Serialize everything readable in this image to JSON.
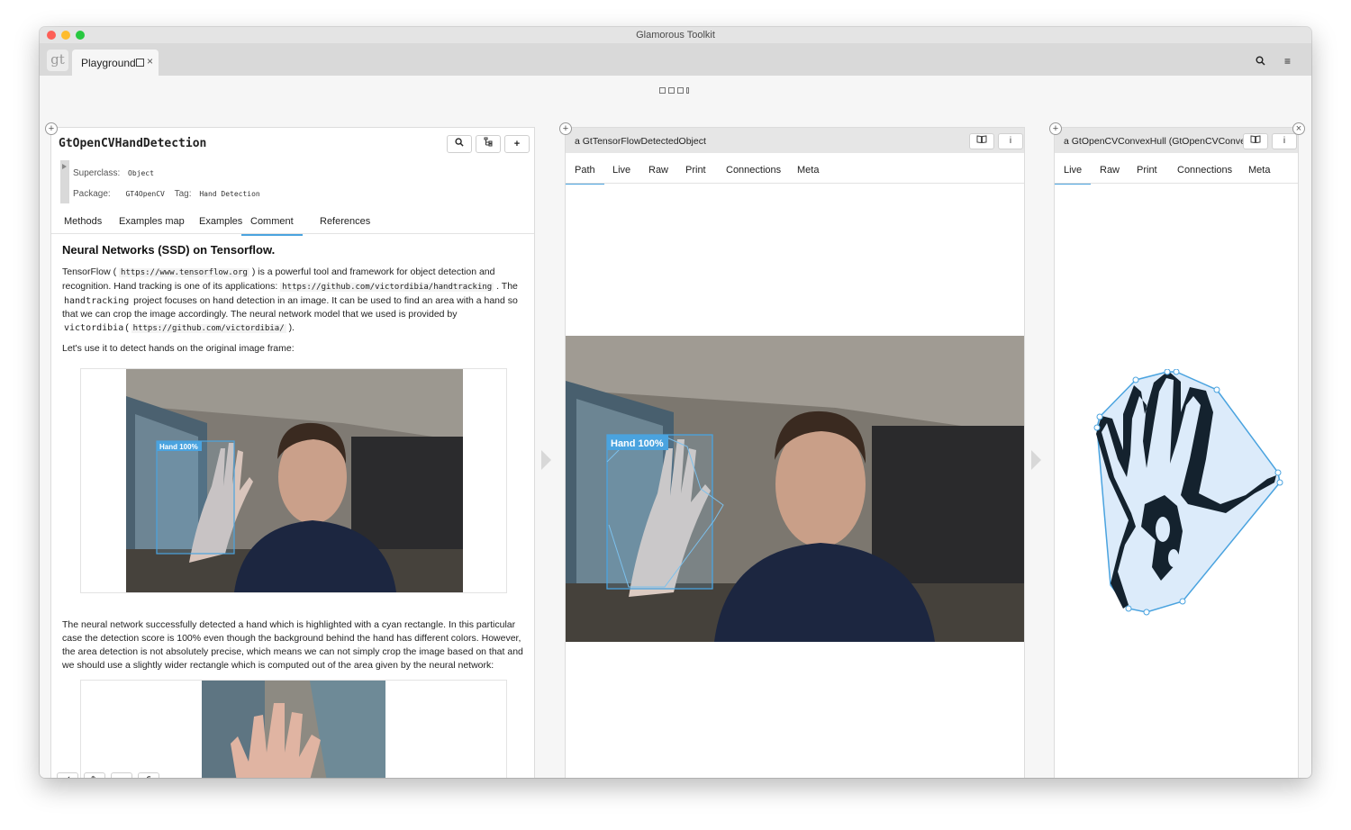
{
  "window": {
    "title": "Glamorous Toolkit"
  },
  "tabstrip": {
    "logo": "gt",
    "tab": {
      "label": "Playground",
      "close": "×"
    },
    "search_icon": "⌕",
    "menu_icon": "≡"
  },
  "left_pane": {
    "class_name": "GtOpenCVHandDetection",
    "superclass_label": "Superclass:",
    "superclass_value": "Object",
    "package_label": "Package:",
    "package_value": "GT4OpenCV",
    "tag_label": "Tag:",
    "tag_value": "Hand Detection",
    "tabs": [
      "Methods",
      "Examples map",
      "Examples",
      "Comment",
      "References"
    ],
    "active_tab": "Comment",
    "doc": {
      "heading": "Neural Networks (SSD) on Tensorflow.",
      "p1_a": "TensorFlow (",
      "p1_url1": "https://www.tensorflow.org",
      "p1_b": ") is a powerful tool and framework for object detection and recognition. Hand tracking is one of its applications:",
      "p1_url2": "https://github.com/victordibia/handtracking",
      "p1_c": ". The",
      "p1_handtracking": "handtracking",
      "p1_d": "project focuses on hand detection in an image. It can be used to find an area with a hand so that we can crop the image accordingly. The neural network model that we used is provided by",
      "p1_author": "victordibia",
      "p1_e": "(",
      "p1_url3": "https://github.com/victordibia/",
      "p1_f": ").",
      "p2": "Let's use it to detect hands on the original image frame:",
      "detect_label": "Hand 100%",
      "p3": "The neural network successfully detected a hand which is highlighted with a cyan rectangle. In this particular case the detection score is 100% even though the background behind the hand has different colors. However, the area detection is not absolutely precise, which means we can not simply crop the image based on that and we should use a slightly wider rectangle which is computed out of the area given by the neural network:"
    },
    "tools": [
      "✓",
      "✎",
      "☁",
      "⎙"
    ]
  },
  "mid_pane": {
    "title": "a GtTensorFlowDetectedObject",
    "book_icon": "📖",
    "info_icon": "i",
    "tabs": [
      "Path",
      "Live",
      "Raw",
      "Print",
      "Connections",
      "Meta"
    ],
    "active_tab": "Path",
    "detect_label": "Hand 100%"
  },
  "right_pane": {
    "title": "a GtOpenCVConvexHull (GtOpenCVConvex",
    "book_icon": "📖",
    "info_icon": "i",
    "close_icon": "×",
    "tabs": [
      "Live",
      "Raw",
      "Print",
      "Connections",
      "Meta"
    ],
    "active_tab": "Live"
  },
  "colors": {
    "accent": "#4aa3df",
    "hull_fill": "#dcebfa",
    "hand_dark": "#14222e"
  }
}
